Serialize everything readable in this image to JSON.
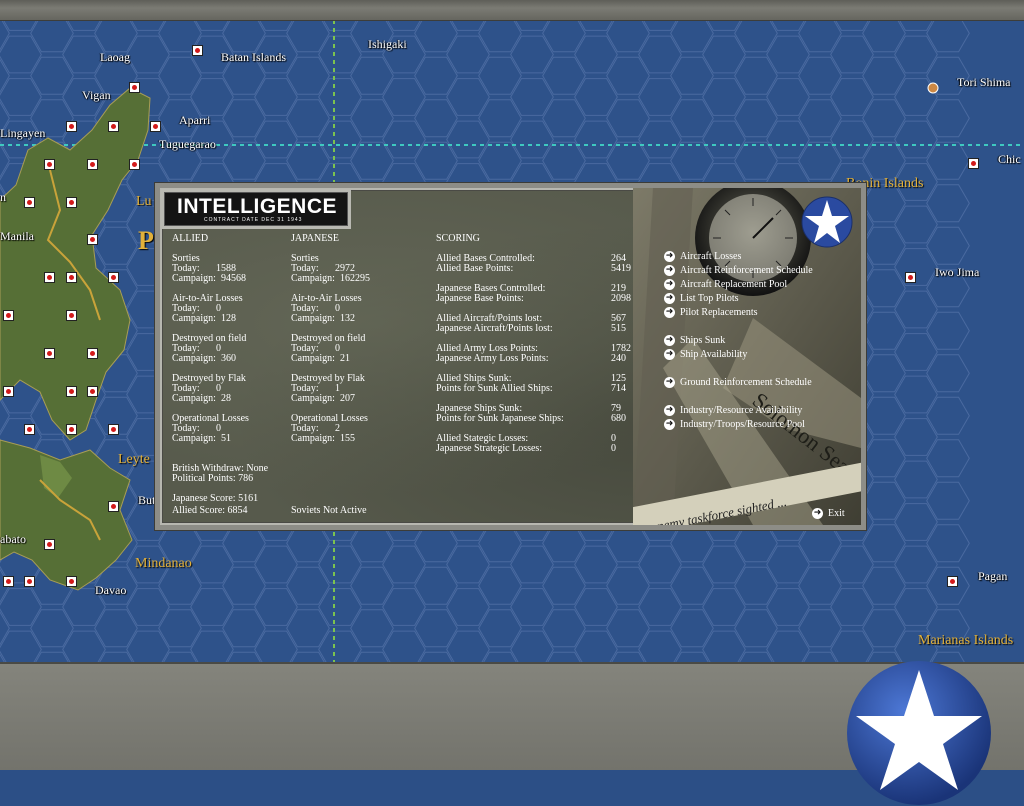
{
  "map": {
    "towns": [
      {
        "name": "Laoag"
      },
      {
        "name": "Batan Islands"
      },
      {
        "name": "Ishigaki"
      },
      {
        "name": "Vigan"
      },
      {
        "name": "Aparri"
      },
      {
        "name": "Lingayen"
      },
      {
        "name": "Tuguegarao"
      },
      {
        "name": "Tori Shima"
      },
      {
        "name": "Chic"
      },
      {
        "name": "Iwo Jima"
      },
      {
        "name": "Pagan"
      },
      {
        "name": "Davao"
      },
      {
        "name": "Butu"
      },
      {
        "name": "abato"
      },
      {
        "name": "n"
      },
      {
        "name": "Manila"
      },
      {
        "name": "Lu"
      }
    ],
    "regions": [
      {
        "name": "Bonin Islands"
      },
      {
        "name": "Mindanao"
      },
      {
        "name": "Leyte"
      },
      {
        "name": "Marianas Islands"
      },
      {
        "name": "P"
      }
    ]
  },
  "dialog": {
    "title": "INTELLIGENCE",
    "contract_date": "CONTRACT DATE DEC 31 1943",
    "allied": {
      "header": "ALLIED",
      "sorties": {
        "label": "Sorties",
        "today": "Today:",
        "today_val": "1588",
        "campaign": "Campaign:",
        "campaign_val": "94568"
      },
      "air_to_air": {
        "label": "Air-to-Air Losses",
        "today": "Today:",
        "today_val": "0",
        "campaign": "Campaign:",
        "campaign_val": "128"
      },
      "destroyed_field": {
        "label": "Destroyed on field",
        "today": "Today:",
        "today_val": "0",
        "campaign": "Campaign:",
        "campaign_val": "360"
      },
      "destroyed_flak": {
        "label": "Destroyed by Flak",
        "today": "Today:",
        "today_val": "0",
        "campaign": "Campaign:",
        "campaign_val": "28"
      },
      "operational": {
        "label": "Operational Losses",
        "today": "Today:",
        "today_val": "0",
        "campaign": "Campaign:",
        "campaign_val": "51"
      }
    },
    "japanese": {
      "header": "JAPANESE",
      "sorties": {
        "label": "Sorties",
        "today": "Today:",
        "today_val": "2972",
        "campaign": "Campaign:",
        "campaign_val": "162295"
      },
      "air_to_air": {
        "label": "Air-to-Air Losses",
        "today": "Today:",
        "today_val": "0",
        "campaign": "Campaign:",
        "campaign_val": "132"
      },
      "destroyed_field": {
        "label": "Destroyed on field",
        "today": "Today:",
        "today_val": "0",
        "campaign": "Campaign:",
        "campaign_val": "21"
      },
      "destroyed_flak": {
        "label": "Destroyed by Flak",
        "today": "Today:",
        "today_val": "1",
        "campaign": "Campaign:",
        "campaign_val": "207"
      },
      "operational": {
        "label": "Operational Losses",
        "today": "Today:",
        "today_val": "2",
        "campaign": "Campaign:",
        "campaign_val": "155"
      }
    },
    "british_withdraw": "British Withdraw: None",
    "political_points": "Political Points: 786",
    "japanese_score": "Japanese Score: 5161",
    "allied_score": "Allied Score: 6854",
    "soviets": "Soviets Not Active",
    "scoring": {
      "header": "SCORING",
      "rows": [
        {
          "label": "Allied Bases Controlled:",
          "value": "264"
        },
        {
          "label": "Allied Base Points:",
          "value": "5419"
        },
        {
          "label": "Japanese Bases Controlled:",
          "value": "219"
        },
        {
          "label": "Japanese Base Points:",
          "value": "2098"
        },
        {
          "label": "Allied Aircraft/Points lost:",
          "value": "567"
        },
        {
          "label": "Japanese Aircraft/Points lost:",
          "value": "515"
        },
        {
          "label": "Allied Army Loss Points:",
          "value": "1782"
        },
        {
          "label": "Japanese Army Loss Points:",
          "value": "240"
        },
        {
          "label": "Allied Ships Sunk:",
          "value": "125"
        },
        {
          "label": "Points for Sunk Allied Ships:",
          "value": "714"
        },
        {
          "label": "Japanese Ships Sunk:",
          "value": "79"
        },
        {
          "label": "Points for Sunk Japanese Ships:",
          "value": "680"
        },
        {
          "label": "Allied Stategic Losses:",
          "value": "0"
        },
        {
          "label": "Japanese Strategic Losses:",
          "value": "0"
        }
      ]
    },
    "menu": [
      {
        "label": "Aircraft Losses"
      },
      {
        "label": "Aircraft Reinforcement Schedule"
      },
      {
        "label": "Aircraft Replacement Pool"
      },
      {
        "label": "List Top Pilots"
      },
      {
        "label": "Pilot Replacements"
      },
      {
        "label": "Ships Sunk"
      },
      {
        "label": "Ship Availability"
      },
      {
        "label": "Ground Reinforcement Schedule"
      },
      {
        "label": "Industry/Resource Availability"
      },
      {
        "label": "Industry/Troops/Resource Pool"
      }
    ],
    "photo_caption": "... enemy taskforce sighted ...",
    "photo_stamp": "Solomon Sea",
    "exit_label": "Exit"
  },
  "colors": {
    "ocean": "#2e528a",
    "hex_line": "#4a6aa0",
    "land": "#5a7a3a",
    "region_label": "#e2b13a",
    "dialog_bg": "#575a4c",
    "star_blue": "#2a4aa0"
  }
}
